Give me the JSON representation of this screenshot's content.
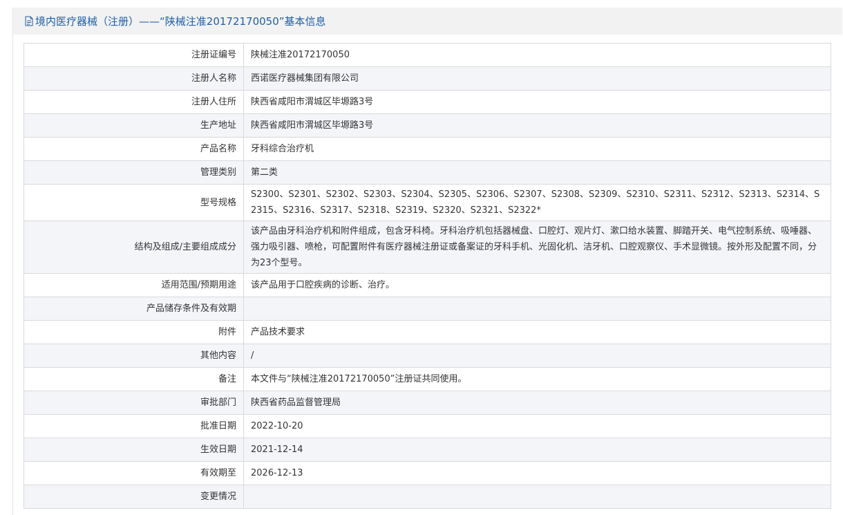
{
  "header": {
    "title": "境内医疗器械（注册）——“陕械注准20172170050”基本信息",
    "icon": "document-icon",
    "title_color": "#1f5fa6"
  },
  "rows": [
    {
      "label": "注册证编号",
      "value": "陕械注准20172170050"
    },
    {
      "label": "注册人名称",
      "value": "西诺医疗器械集团有限公司"
    },
    {
      "label": "注册人住所",
      "value": "陕西省咸阳市渭城区毕塬路3号"
    },
    {
      "label": "生产地址",
      "value": "陕西省咸阳市渭城区毕塬路3号"
    },
    {
      "label": "产品名称",
      "value": "牙科综合治疗机"
    },
    {
      "label": "管理类别",
      "value": "第二类"
    },
    {
      "label": "型号规格",
      "value": "S2300、S2301、S2302、S2303、S2304、S2305、S2306、S2307、S2308、S2309、S2310、S2311、S2312、S2313、S2314、S2315、S2316、S2317、S2318、S2319、S2320、S2321、S2322*"
    },
    {
      "label": "结构及组成/主要组成成分",
      "value": "该产品由牙科治疗机和附件组成，包含牙科椅。牙科治疗机包括器械盘、口腔灯、观片灯、漱口给水装置、脚踏开关、电气控制系统、吸唾器、强力吸引器、喷枪，可配置附件有医疗器械注册证或备案证的牙科手机、光固化机、洁牙机、口腔观察仪、手术显微镜。按外形及配置不同，分为23个型号。"
    },
    {
      "label": "适用范围/预期用途",
      "value": "该产品用于口腔疾病的诊断、治疗。"
    },
    {
      "label": "产品储存条件及有效期",
      "value": ""
    },
    {
      "label": "附件",
      "value": "产品技术要求"
    },
    {
      "label": "其他内容",
      "value": "/"
    },
    {
      "label": "备注",
      "value": "本文件与“陕械注准20172170050”注册证共同使用。"
    },
    {
      "label": "审批部门",
      "value": "陕西省药品监督管理局"
    },
    {
      "label": "批准日期",
      "value": "2022-10-20"
    },
    {
      "label": "生效日期",
      "value": "2021-12-14"
    },
    {
      "label": "有效期至",
      "value": "2026-12-13"
    },
    {
      "label": "变更情况",
      "value": ""
    }
  ]
}
